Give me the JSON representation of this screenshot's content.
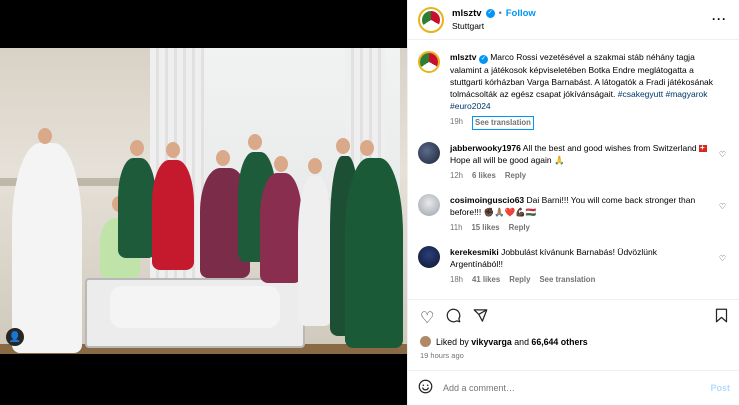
{
  "post": {
    "username": "mlsztv",
    "follow_label": "Follow",
    "location": "Stuttgart",
    "caption_user": "mlsztv",
    "caption_text": "Marco Rossi vezetésével a szakmai stáb néhány tagja valamint a játékosok képviseletében Botka Endre meglátogatta a stuttgarti kórházban Varga Barnabást. A látogatók a Fradi játékosának tolmácsolták az egész csapat jókívánságait.",
    "caption_tags": "#csakegyutt #magyarok #euro2024",
    "caption_time": "19h",
    "see_translation": "See translation"
  },
  "comments": [
    {
      "username": "jabberwooky1976",
      "text_a": "All the best and good wishes from Switzerland",
      "text_b": "Hope all will be good again 🙏",
      "time": "12h",
      "likes": "6 likes",
      "reply": "Reply"
    },
    {
      "username": "cosimoinguscio63",
      "text": "Dai Barni!!! You will come back stronger than before!!! ✊🏿🙏🏽❤️💪🏿🇭🇺",
      "time": "11h",
      "likes": "15 likes",
      "reply": "Reply"
    },
    {
      "username": "kerekesmiki",
      "text": "Jobbulást kívánunk Barnabás! Üdvözlünk Argentínából!!",
      "time": "18h",
      "likes": "41 likes",
      "reply": "Reply",
      "see_translation": "See translation"
    }
  ],
  "likes": {
    "prefix": "Liked by",
    "user": "vikyvarga",
    "middle": "and",
    "count": "66,644 others"
  },
  "post_time": "19 hours ago",
  "composer": {
    "placeholder": "Add a comment…",
    "post_label": "Post"
  },
  "colors": {
    "accent": "#0095f6",
    "post_disabled": "#b3dbff"
  },
  "icons": {
    "more": "more-horizontal-icon",
    "like": "heart-icon",
    "comment": "comment-icon",
    "share": "share-icon",
    "save": "bookmark-icon",
    "emoji": "emoji-icon",
    "tagged": "user-tag-icon"
  }
}
